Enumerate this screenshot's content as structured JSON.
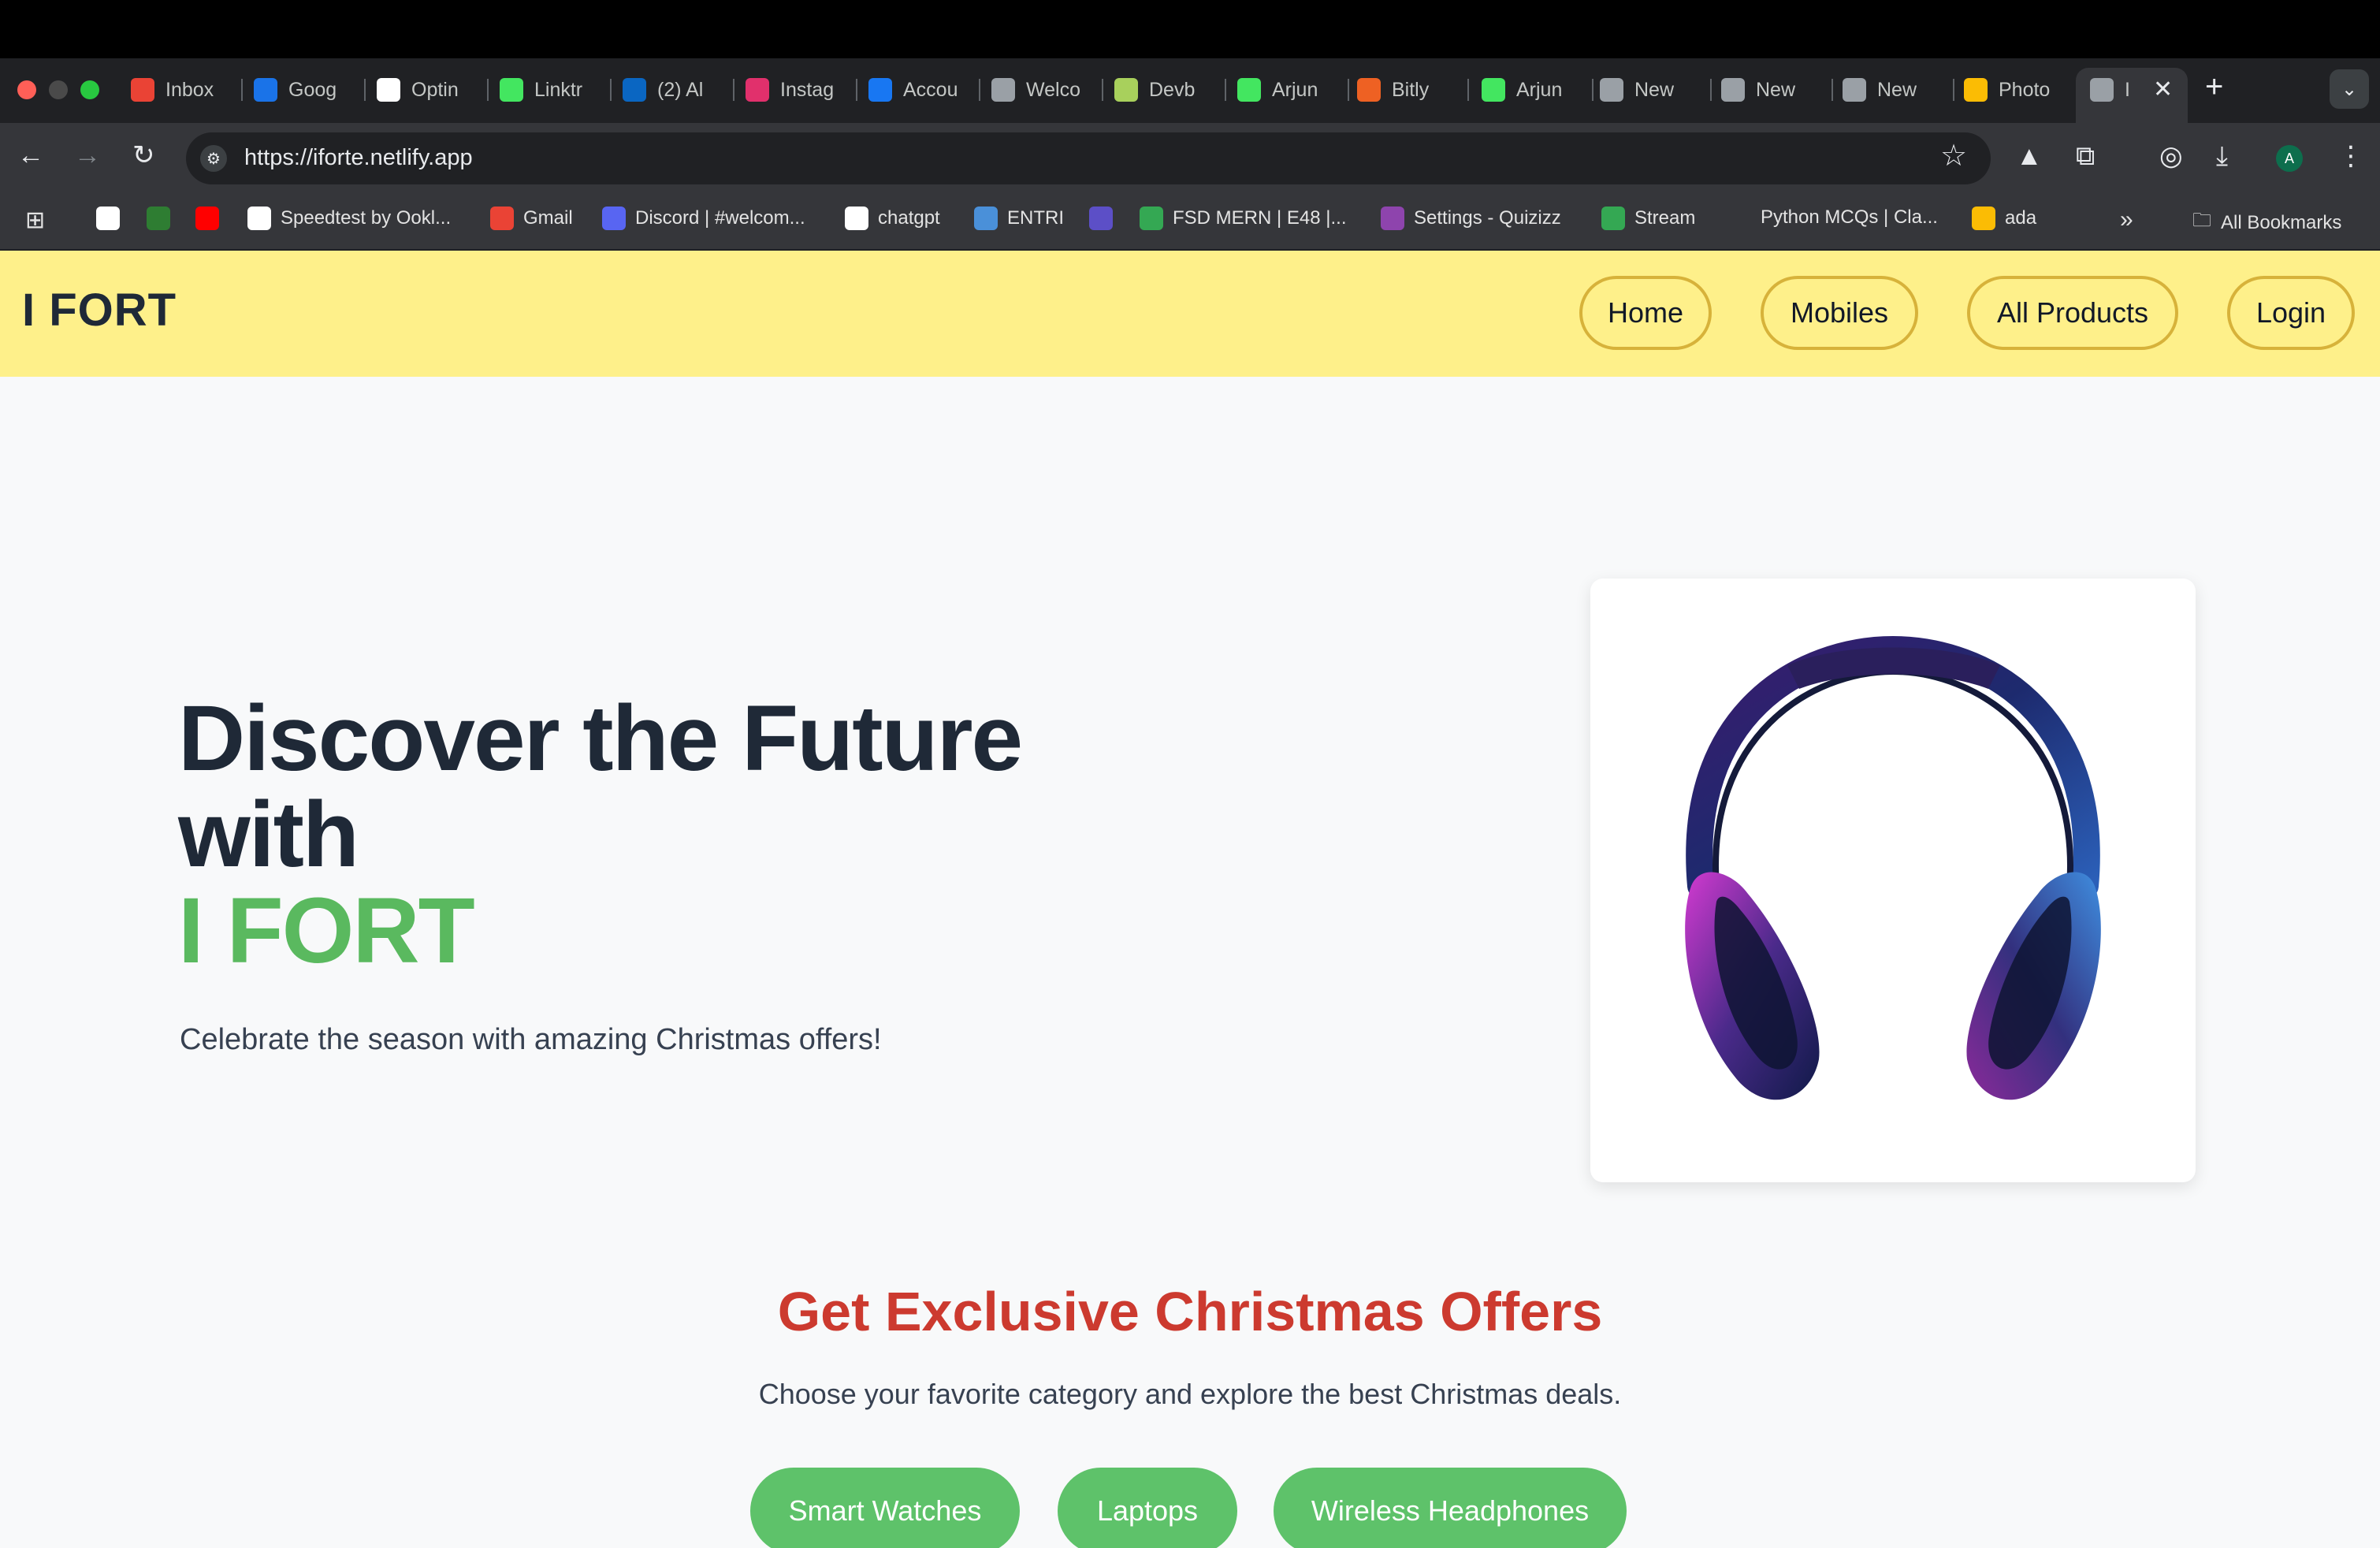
{
  "browser": {
    "tabs": [
      {
        "label": "Inbox",
        "icon": "gmail-icon",
        "color": "#ea4335"
      },
      {
        "label": "Goog",
        "icon": "meet-icon",
        "color": "#1a73e8"
      },
      {
        "label": "Optin",
        "icon": "openai-icon",
        "color": "#ffffff"
      },
      {
        "label": "Linktr",
        "icon": "linktree-icon",
        "color": "#43e660"
      },
      {
        "label": "(2) Al",
        "icon": "linkedin-icon",
        "color": "#0a66c2"
      },
      {
        "label": "Instag",
        "icon": "instagram-icon",
        "color": "#e1306c"
      },
      {
        "label": "Accou",
        "icon": "facebook-icon",
        "color": "#1877f2"
      },
      {
        "label": "Welco",
        "icon": "store-icon",
        "color": "#9aa0a6"
      },
      {
        "label": "Devb",
        "icon": "doc-icon",
        "color": "#a8d05c"
      },
      {
        "label": "Arjun",
        "icon": "linktree-icon",
        "color": "#43e660"
      },
      {
        "label": "Bitly",
        "icon": "bitly-icon",
        "color": "#ee6123"
      },
      {
        "label": "Arjun",
        "icon": "linktree-icon",
        "color": "#43e660"
      },
      {
        "label": "New",
        "icon": "chrome-icon",
        "color": "#9aa0a6"
      },
      {
        "label": "New",
        "icon": "chrome-icon",
        "color": "#9aa0a6"
      },
      {
        "label": "New",
        "icon": "chrome-icon",
        "color": "#9aa0a6"
      },
      {
        "label": "Photo",
        "icon": "photos-icon",
        "color": "#fbbc04"
      },
      {
        "label": "I",
        "icon": "globe-icon",
        "color": "#9aa0a6"
      }
    ],
    "url": "https://iforte.netlify.app",
    "avatar_letter": "A",
    "bookmarks": [
      {
        "label": "",
        "icon": "google-icon",
        "color": "#ffffff"
      },
      {
        "label": "",
        "icon": "finance-icon",
        "color": "#2e7d32"
      },
      {
        "label": "",
        "icon": "youtube-icon",
        "color": "#ff0000"
      },
      {
        "label": "Speedtest by Ookl...",
        "icon": "speedtest-icon",
        "color": "#ffffff"
      },
      {
        "label": "Gmail",
        "icon": "gmail-icon",
        "color": "#ea4335"
      },
      {
        "label": "Discord | #welcom...",
        "icon": "discord-icon",
        "color": "#5865f2"
      },
      {
        "label": "chatgpt",
        "icon": "openai-icon",
        "color": "#ffffff"
      },
      {
        "label": "ENTRI",
        "icon": "entri-icon",
        "color": "#4a90d9"
      },
      {
        "label": "",
        "icon": "circle-icon",
        "color": "#5c4fc7"
      },
      {
        "label": "FSD MERN | E48 |...",
        "icon": "classroom-icon",
        "color": "#34a853"
      },
      {
        "label": "Settings - Quizizz",
        "icon": "quizizz-icon",
        "color": "#8e44ad"
      },
      {
        "label": "Stream",
        "icon": "classroom-icon",
        "color": "#34a853"
      },
      {
        "label": "Python MCQs | Cla...",
        "icon": "",
        "color": ""
      },
      {
        "label": "ada",
        "icon": "photos-icon",
        "color": "#fbbc04"
      }
    ],
    "all_bookmarks": "All Bookmarks",
    "overflow": "»"
  },
  "site": {
    "brand": "I FORT",
    "nav": [
      "Home",
      "Mobiles",
      "All Products",
      "Login"
    ],
    "hero": {
      "line1": "Discover the Future",
      "line2": "with",
      "accent": "I FORT",
      "subtitle": "Celebrate the season with amazing Christmas offers!"
    },
    "offers": {
      "title": "Get Exclusive Christmas Offers",
      "subtitle": "Choose your favorite category and explore the best Christmas deals.",
      "categories": [
        "Smart Watches",
        "Laptops",
        "Wireless Headphones"
      ]
    },
    "colors": {
      "header_bg": "#fef08a",
      "accent_green": "#5ab95f",
      "offers_red": "#cc3a2f",
      "button_green": "#5ec26a"
    }
  }
}
